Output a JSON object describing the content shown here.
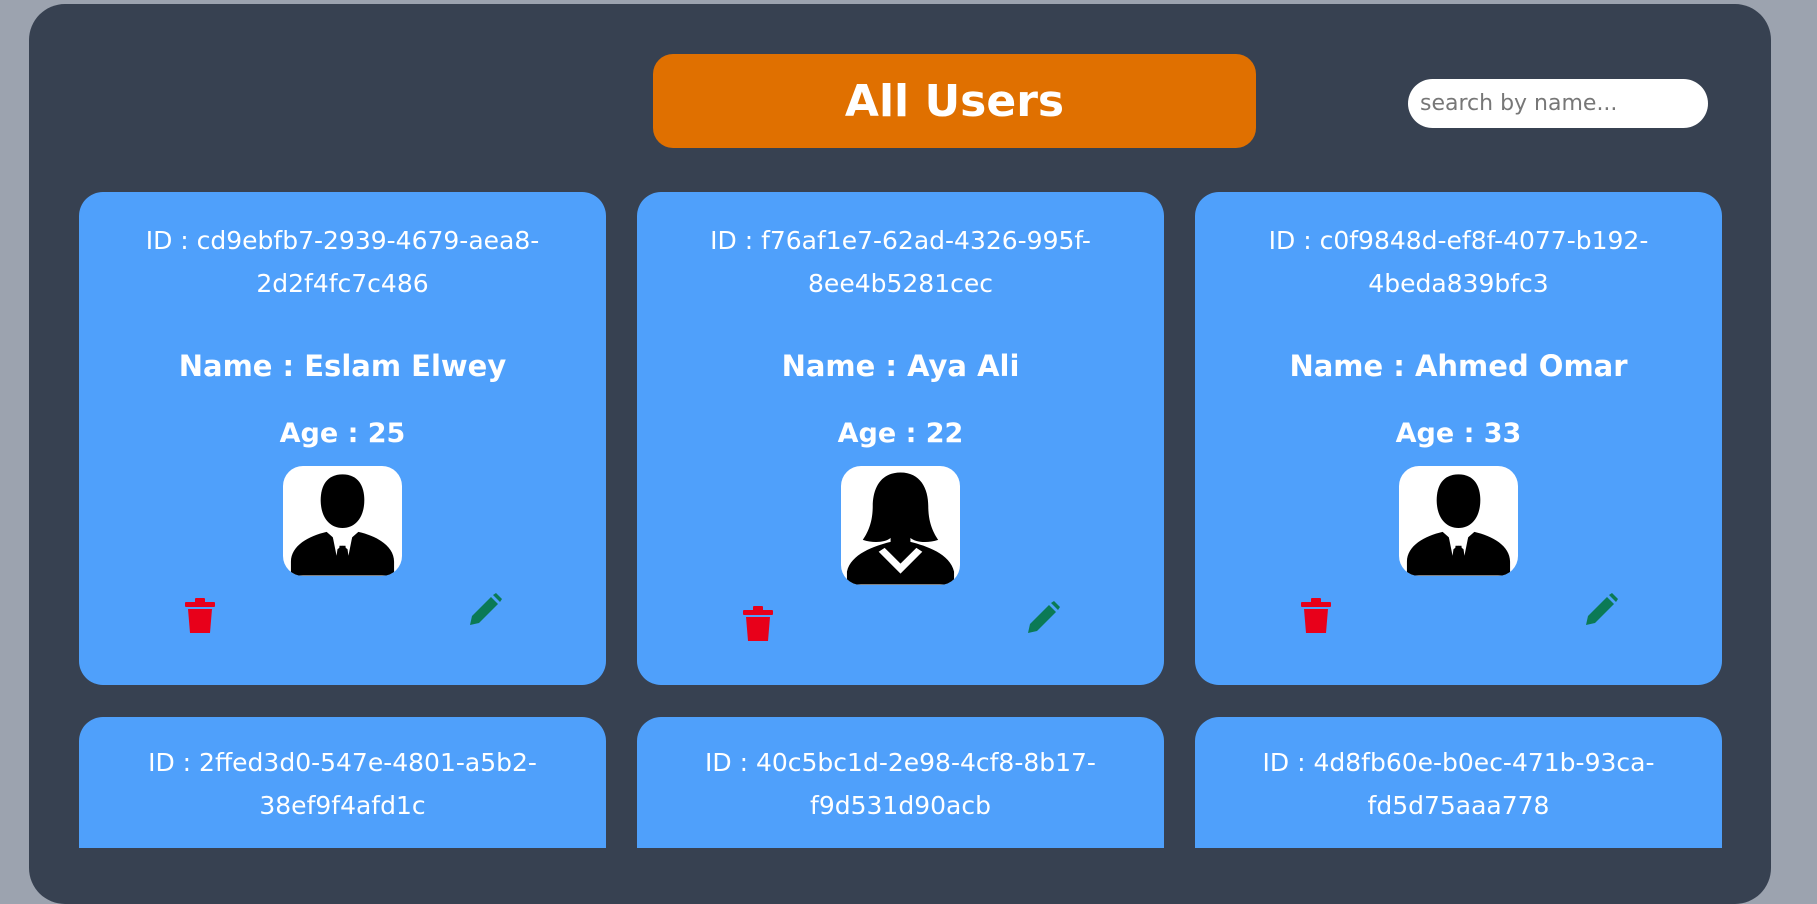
{
  "header": {
    "title": "All Users"
  },
  "search": {
    "placeholder": "search by name...",
    "value": ""
  },
  "colors": {
    "background": "#9ca3af",
    "panel": "#374151",
    "title_pill": "#e07000",
    "card": "#4fa0fb",
    "delete_icon": "#e8001a",
    "edit_icon": "#0b7a55"
  },
  "users": [
    {
      "id_text": "ID : cd9ebfb7-2939-4679-aea8-2d2f4fc7c486",
      "name_text": "Name : Eslam Elwey",
      "age_text": "Age : 25",
      "avatar": "male-avatar-icon"
    },
    {
      "id_text": "ID : f76af1e7-62ad-4326-995f-8ee4b5281cec",
      "name_text": "Name : Aya Ali",
      "age_text": "Age : 22",
      "avatar": "female-avatar-icon"
    },
    {
      "id_text": "ID : c0f9848d-ef8f-4077-b192-4beda839bfc3",
      "name_text": "Name : Ahmed Omar",
      "age_text": "Age : 33",
      "avatar": "male-avatar-icon"
    },
    {
      "id_text": "ID : 2ffed3d0-547e-4801-a5b2-38ef9f4afd1c"
    },
    {
      "id_text": "ID : 40c5bc1d-2e98-4cf8-8b17-f9d531d90acb"
    },
    {
      "id_text": "ID : 4d8fb60e-b0ec-471b-93ca-fd5d75aaa778"
    }
  ]
}
